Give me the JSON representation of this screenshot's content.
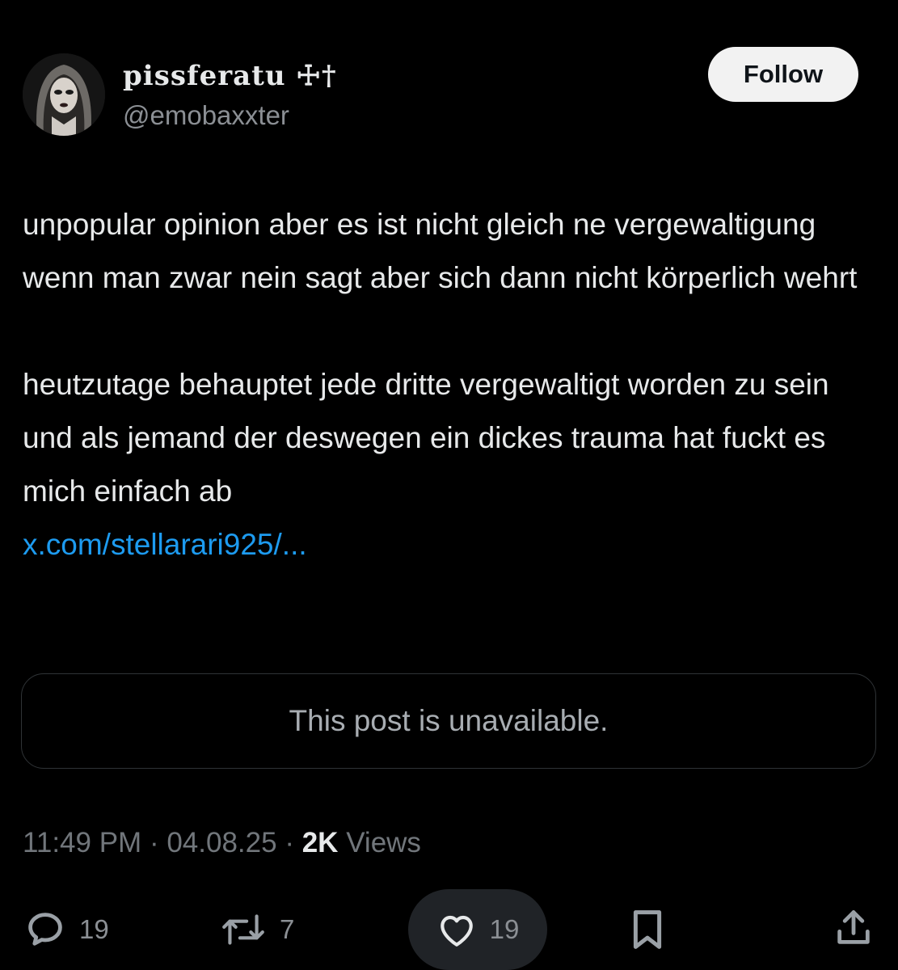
{
  "header": {
    "display_name": "pissferatu ☩†",
    "handle": "@emobaxxter",
    "follow_label": "Follow"
  },
  "tweet": {
    "paragraphs": [
      "unpopular opinion aber es ist nicht gleich ne vergewaltigung wenn man zwar nein sagt aber sich dann nicht körperlich wehrt",
      "heutzutage behauptet jede dritte vergewaltigt worden zu sein und als jemand der deswegen ein dickes trauma hat fuckt es mich einfach ab"
    ],
    "link": "x.com/stellarari925/..."
  },
  "quote": {
    "unavailable_text": "This post is unavailable."
  },
  "meta": {
    "time": "11:49 PM",
    "separator": "·",
    "date": "04.08.25",
    "views_count": "2K",
    "views_label": "Views"
  },
  "actions": {
    "reply_count": "19",
    "repost_count": "7",
    "like_count": "19"
  },
  "colors": {
    "background": "#000000",
    "text": "#e7e9ea",
    "muted": "#71767b",
    "link": "#1d9bf0",
    "follow_bg": "#f2f2f2"
  },
  "icons": [
    "avatar",
    "reply-icon",
    "repost-icon",
    "like-icon",
    "bookmark-icon",
    "share-icon"
  ]
}
